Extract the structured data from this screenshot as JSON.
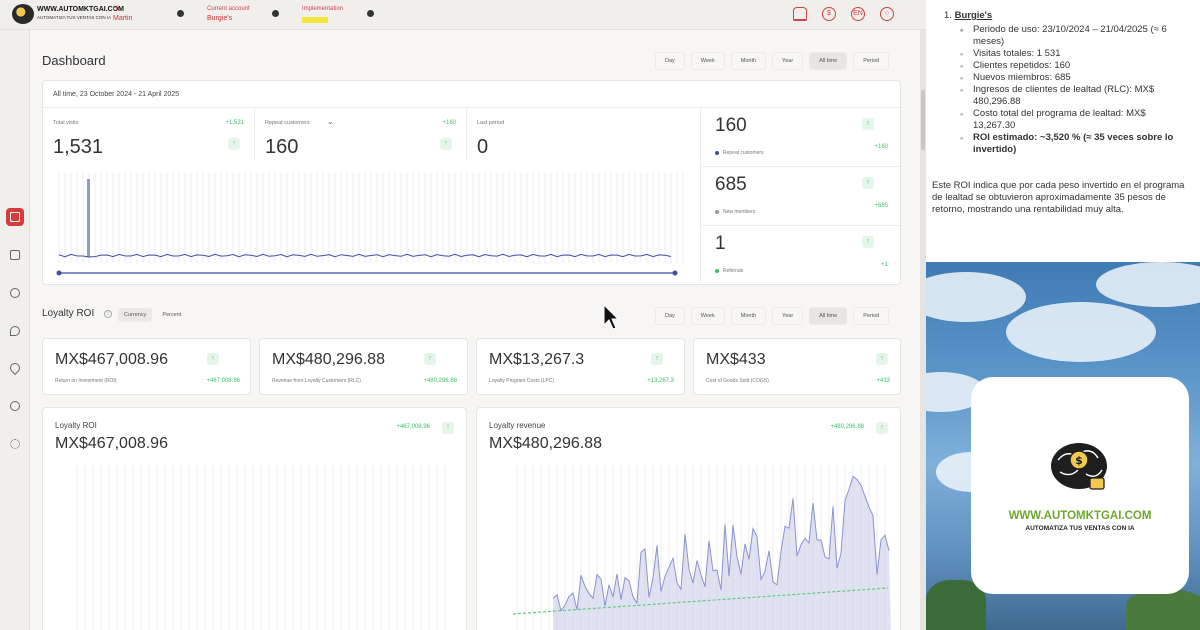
{
  "topbar": {
    "logo_line1": "WWW.AUTOMKTGAI.COM",
    "logo_line2": "AUTOMATIZA TUS VENTAS CON IA",
    "hi_label": "Hi",
    "user_name": "Martin",
    "account_label": "Current account",
    "account_name": "Burgie's",
    "implementation_label": "Implementation",
    "icons": [
      "bell-icon",
      "dollar-icon",
      "language-icon",
      "user-icon"
    ],
    "lang": "EN"
  },
  "sidebar": {
    "items": [
      "home-icon",
      "receipt-icon",
      "users-icon",
      "chat-icon",
      "location-icon",
      "team-icon",
      "settings-icon"
    ],
    "active_color": "#d63b3b"
  },
  "range_tabs": [
    "Day",
    "Week",
    "Month",
    "Year",
    "All time",
    "Period"
  ],
  "range_active": "All time",
  "dashboard": {
    "title": "Dashboard",
    "date_range": "All time, 23 October 2024 - 21 April 2025",
    "stats": [
      {
        "label": "Total visits",
        "value": "1,531",
        "delta": "+1,531"
      },
      {
        "label": "Repeat customers",
        "value": "160",
        "delta": "+160"
      },
      {
        "label": "Last period",
        "value": "0",
        "delta": ""
      }
    ],
    "side_metrics": [
      {
        "value": "160",
        "label": "Repeat customers",
        "delta": "+160",
        "color": "#3b4fa0"
      },
      {
        "value": "685",
        "label": "New members",
        "delta": "+685",
        "color": "#999999"
      },
      {
        "value": "1",
        "label": "Referrals",
        "delta": "+1",
        "color": "#3fbf6b"
      }
    ]
  },
  "loyalty": {
    "title": "Loyalty ROI",
    "toggle": [
      "Currency",
      "Percent"
    ],
    "toggle_active": "Currency",
    "cards": [
      {
        "amount": "MX$467,008.96",
        "label": "Return on Investment (ROI)",
        "delta": "+467,008.96"
      },
      {
        "amount": "MX$480,296.88",
        "label": "Revenue from Loyalty Customers (RLC)",
        "delta": "+480,296.88"
      },
      {
        "amount": "MX$13,267.3",
        "label": "Loyalty Program Costs (LPC)",
        "delta": "+13,267.3"
      },
      {
        "amount": "MX$433",
        "label": "Cost of Goods Sold (COGS)",
        "delta": "+433"
      }
    ],
    "roi_chart": {
      "title": "Loyalty ROI",
      "amount": "MX$467,008.96",
      "delta": "+467,008.96"
    },
    "revenue_chart": {
      "title": "Loyalty revenue",
      "amount": "MX$480,296.88",
      "delta": "+480,296.88"
    }
  },
  "note": {
    "heading_number": "1.",
    "heading": "Burgie's",
    "items": [
      "",
      "Periodo de uso: 23/10/2024 – 21/04/2025 (≈ 6 meses)",
      "Visitas totales: 1 531",
      "Clientes repetidos: 160",
      "Nuevos miembros: 685",
      "Ingresos de clientes de lealtad (RLC): MX$ 480,296.88",
      "Costo total del programa de lealtad: MX$ 13,267.30",
      "ROI estimado: ~3,520 % (≈ 35 veces sobre lo invertido)"
    ],
    "paragraph": "Este ROI indica que por cada peso invertido en el programa de lealtad se obtuvieron aproximadamente 35 pesos de retorno, mostrando una rentabilidad muy alta."
  },
  "brand": {
    "name": "WWW.AUTOMKTGAI.COM",
    "tagline": "AUTOMATIZA TUS VENTAS CON IA",
    "green": "#6fa62f"
  }
}
